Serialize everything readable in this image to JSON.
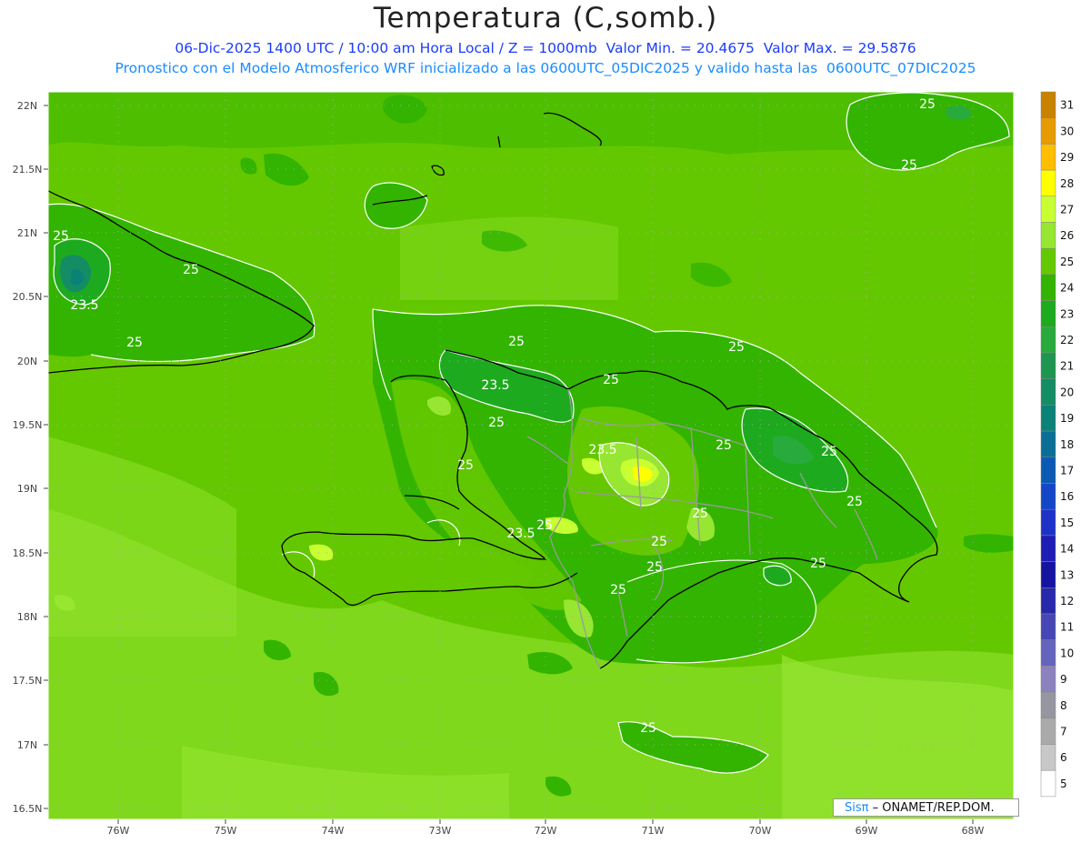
{
  "header": {
    "title": "Temperatura (C,somb.)",
    "subtitle1": "06-Dic-2025 1400 UTC / 10:00 am Hora Local / Z = 1000mb  Valor Min. = 20.4675  Valor Max. = 29.5876",
    "subtitle2": "Pronostico con el Modelo Atmosferico WRF inicializado a las 0600UTC_05DIC2025 y valido hasta las  0600UTC_07DIC2025"
  },
  "axes": {
    "lat_labels": [
      "22N",
      "21.5N",
      "21N",
      "20.5N",
      "20N",
      "19.5N",
      "19N",
      "18.5N",
      "18N",
      "17.5N",
      "17N",
      "16.5N"
    ],
    "lon_labels": [
      "76W",
      "75W",
      "74W",
      "73W",
      "72W",
      "71W",
      "70W",
      "69W",
      "68W"
    ]
  },
  "colorbar": {
    "levels": [
      "31",
      "30",
      "29",
      "28",
      "27",
      "26",
      "25",
      "24",
      "23",
      "22",
      "21",
      "20",
      "19",
      "18",
      "17",
      "16",
      "15",
      "14",
      "13",
      "12",
      "11",
      "10",
      "9",
      "8",
      "7",
      "6",
      "5"
    ],
    "colors": [
      "#c88200",
      "#e69b00",
      "#ffbe00",
      "#ffff00",
      "#c8ff32",
      "#96e632",
      "#64c800",
      "#32b400",
      "#1eaa1e",
      "#28aa3c",
      "#1e9650",
      "#148c64",
      "#0a8278",
      "#0a6e96",
      "#0a5ab4",
      "#1446c8",
      "#1e32c8",
      "#1e1eb4",
      "#1414a0",
      "#2828aa",
      "#4646b4",
      "#6464be",
      "#8c82be",
      "#9696a0",
      "#aaaaaa",
      "#c8c8c8",
      "#ffffff"
    ]
  },
  "contour_labels": [
    "25",
    "25",
    "25",
    "23.5",
    "25",
    "25",
    "25",
    "25",
    "23.5",
    "25",
    "25",
    "25",
    "23.5",
    "25",
    "25",
    "25",
    "25",
    "23.5",
    "25",
    "25",
    "25",
    "25",
    "25",
    "25",
    "25",
    "25",
    "25",
    "25",
    "25"
  ],
  "credit": {
    "logo": "Sisπ",
    "text": "– ONAMET/REP.DOM."
  }
}
